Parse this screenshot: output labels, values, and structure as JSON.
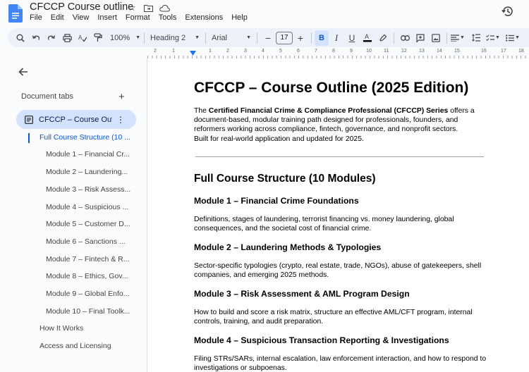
{
  "document": {
    "title": "CFCCP Course outline",
    "menu": [
      "File",
      "Edit",
      "View",
      "Insert",
      "Format",
      "Tools",
      "Extensions",
      "Help"
    ]
  },
  "toolbar": {
    "zoom": "100%",
    "style": "Heading 2",
    "font": "Arial",
    "font_size": "17"
  },
  "ruler": {
    "numbers": [
      "2",
      "1",
      "1",
      "2",
      "3",
      "4",
      "5",
      "6",
      "7",
      "8",
      "9",
      "10",
      "11",
      "12",
      "13",
      "14",
      "15",
      "16",
      "17",
      "18"
    ]
  },
  "sidebar": {
    "heading": "Document tabs",
    "tab_label": "CFCCP – Course Out...",
    "outline": [
      "Full Course Structure (10 ...",
      "Module 1 – Financial Cr...",
      "Module 2 – Laundering...",
      "Module 3 – Risk Assess...",
      "Module 4 – Suspicious ...",
      "Module 5 – Customer D...",
      "Module 6 – Sanctions ...",
      "Module 7 – Fintech & R...",
      "Module 8 – Ethics, Gov...",
      "Module 9 – Global Enfo...",
      "Module 10 – Final Toolk...",
      "How It Works",
      "Access and Licensing"
    ]
  },
  "content": {
    "title": "CFCCP – Course Outline (2025 Edition)",
    "intro_lead": "The ",
    "intro_bold": "Certified Financial Crime & Compliance Professional (CFCCP) Series",
    "intro_rest": " offers a document-based, modular training path designed for professionals, founders, and reformers working across compliance, fintech, governance, and nonprofit sectors.",
    "intro_line2": "Built for real-world application and updated for 2025.",
    "structure_heading": "Full Course Structure (10 Modules)",
    "modules": [
      {
        "heading": "Module 1 – Financial Crime Foundations",
        "body": "Definitions, stages of laundering, terrorist financing vs. money laundering, global consequences, and the societal cost of financial crime."
      },
      {
        "heading": "Module 2 – Laundering Methods & Typologies",
        "body": "Sector-specific typologies (crypto, real estate, trade, NGOs), abuse of gatekeepers, shell companies, and emerging 2025 methods."
      },
      {
        "heading": "Module 3 – Risk Assessment & AML Program Design",
        "body": "How to build and score a risk matrix, structure an effective AML/CFT program, internal controls, training, and audit preparation."
      },
      {
        "heading": "Module 4 – Suspicious Transaction Reporting & Investigations",
        "body": "Filing STRs/SARs, internal escalation, law enforcement interaction, and how to respond to investigations or subpoenas."
      }
    ]
  }
}
